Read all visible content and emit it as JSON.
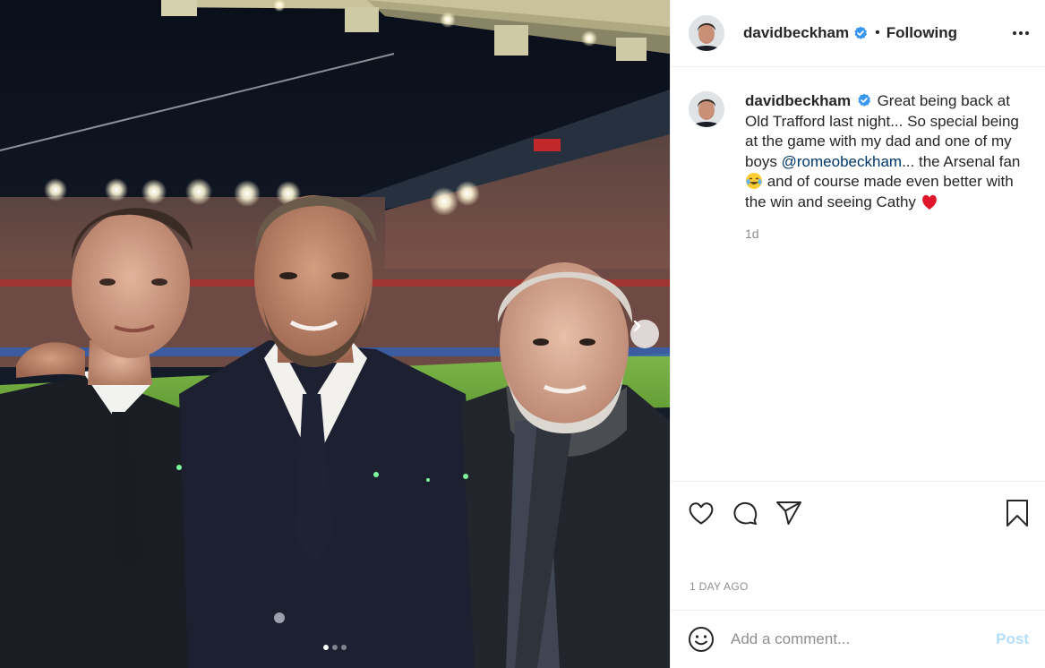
{
  "post": {
    "media": {
      "alt": "Romeo, David and Ted Beckham at Old Trafford",
      "carousel_count": 3,
      "carousel_active_index": 0,
      "next_icon": "chevron-right-icon"
    },
    "header": {
      "username": "davidbeckham",
      "verified_icon": "verified-badge-icon",
      "separator": "•",
      "follow_state": "Following",
      "more_icon": "more-horizontal-icon"
    },
    "caption": {
      "username": "davidbeckham",
      "text_part1": "Great being back at Old Trafford last night... So special being at the game with my dad and one of my boys ",
      "mention": "@romeobeckham",
      "text_part2": "... the Arsenal fan ",
      "emoji1": "tears-of-joy-emoji",
      "text_part3": " and of course made even better with the win and seeing Cathy ",
      "emoji2": "red-heart-emoji",
      "time_ago": "1d"
    },
    "actions": {
      "like_icon": "heart-icon",
      "comment_icon": "comment-bubble-icon",
      "share_icon": "paper-plane-icon",
      "save_icon": "bookmark-icon"
    },
    "date_label": "1 DAY AGO",
    "comment_box": {
      "emoji_icon": "smiley-icon",
      "placeholder": "Add a comment...",
      "post_label": "Post"
    },
    "colors": {
      "verified_blue": "#3897f0",
      "mention_blue": "#00376b",
      "post_disabled": "#b2dffc",
      "muted_text": "#8e8e8e",
      "border": "#efefef"
    }
  }
}
